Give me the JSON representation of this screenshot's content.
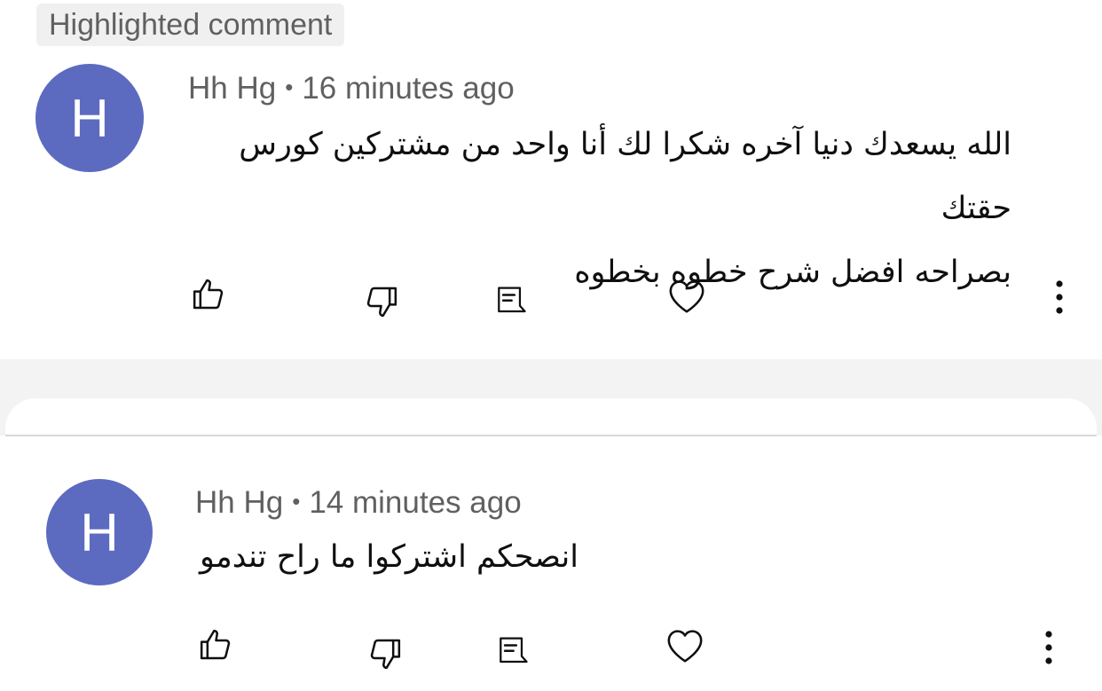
{
  "highlight": {
    "label": "Highlighted comment"
  },
  "comments": [
    {
      "avatar_letter": "H",
      "author": "Hh Hg",
      "separator": "•",
      "time": "16 minutes ago",
      "lines": [
        "الله يسعدك دنيا آخره شكرا لك أنا واحد من مشتركين كورس حقتك",
        "بصراحه افضل شرح خطوه بخطوه"
      ]
    },
    {
      "avatar_letter": "H",
      "author": "Hh Hg",
      "separator": "•",
      "time": "14 minutes ago",
      "lines": [
        "انصحكم اشتركوا ما راح تندمو"
      ]
    }
  ],
  "colors": {
    "avatar": "#5c6bc0",
    "meta": "#606060",
    "text": "#0f0f0f"
  },
  "icons": [
    "thumb-up-icon",
    "thumb-down-icon",
    "reply-icon",
    "heart-icon",
    "more-vert-icon"
  ]
}
